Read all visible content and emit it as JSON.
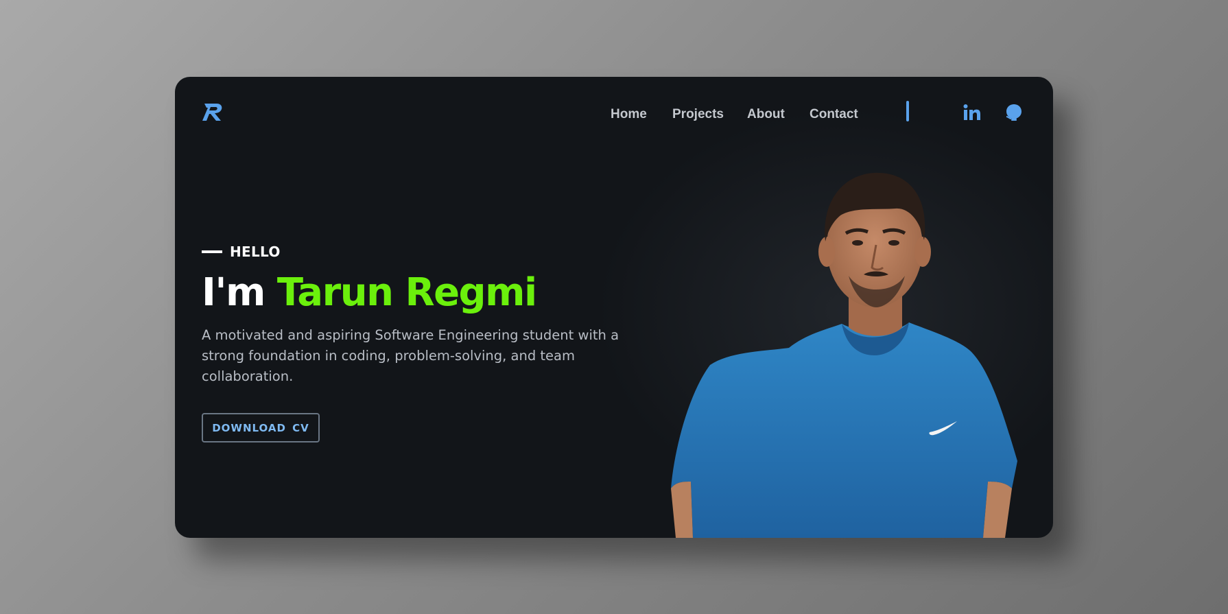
{
  "nav": {
    "links": [
      "Home",
      "Projects",
      "About",
      "Contact"
    ]
  },
  "hero": {
    "hello": "HELLO",
    "headline_prefix": "I'm ",
    "headline_name": "Tarun Regmi",
    "bio": "A motivated and aspiring Software Engineering student with a strong foundation in coding, problem-solving, and team collaboration.",
    "cv_button": "DOWNLOAD CV"
  },
  "icons": {
    "logo": "tr-monogram-logo",
    "linkedin": "linkedin-icon",
    "github": "github-icon"
  },
  "colors": {
    "background": "#121519",
    "accent_green": "#6bf00c",
    "accent_blue": "#5aa2ec",
    "shirt_blue": "#2a78b6"
  }
}
